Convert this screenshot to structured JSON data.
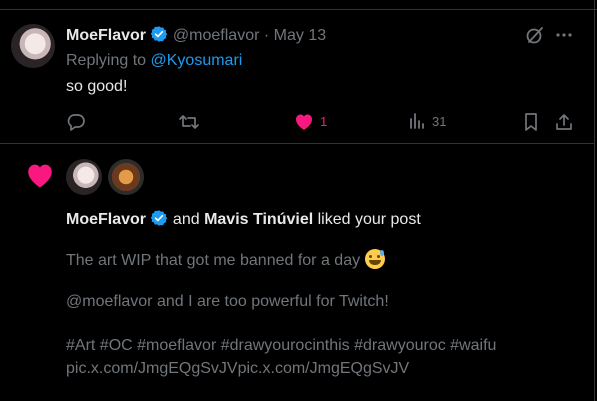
{
  "reply_tweet": {
    "author_name": "MoeFlavor",
    "handle": "@moeflavor",
    "separator": "·",
    "date": "May 13",
    "replying_to_prefix": "Replying to ",
    "replying_to_handle": "@Kyosumari",
    "text": "so good!",
    "actions": {
      "like_count": "1",
      "views_count": "31"
    }
  },
  "notification": {
    "liker_1": "MoeFlavor",
    "conjunction": "and",
    "liker_2": "Mavis Tinúviel",
    "action_text": "liked your post",
    "post_line_1": "The art WIP that got me banned for a day",
    "post_line_2": "@moeflavor  and I are too powerful for Twitch!",
    "post_line_3": "#Art #OC #moeflavor #drawyourocinthis #drawyouroc #waifu",
    "post_line_4": "pic.x.com/JmgEQgSvJVpic.x.com/JmgEQgSvJV"
  },
  "colors": {
    "background": "#000000",
    "text_primary": "#e7e9ea",
    "text_secondary": "#71767b",
    "accent_blue": "#1d9bf0",
    "like_pink": "#f91880",
    "border": "#2f3336"
  },
  "icons": [
    "verified-badge-icon",
    "grok-icon",
    "more-icon",
    "reply-icon",
    "retweet-icon",
    "heart-icon",
    "views-icon",
    "bookmark-icon",
    "share-icon",
    "emoji-sweat-smile-icon"
  ]
}
